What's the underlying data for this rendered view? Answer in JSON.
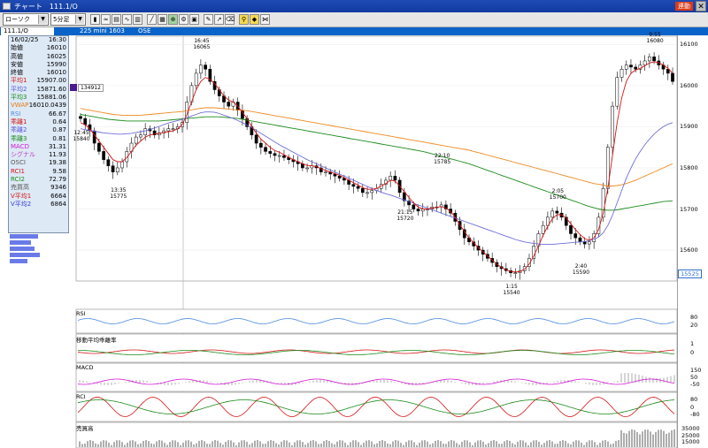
{
  "window": {
    "title": "チャート　111.1/O",
    "badge": "連動",
    "close": "✕"
  },
  "toolbar": {
    "period_select": "ローソク",
    "interval_select": "5分足"
  },
  "infobar": {
    "symbol": "111.1/O",
    "contract": "225 mini 1603",
    "exchange": "OSE"
  },
  "info_panel": [
    {
      "label": "16/02/25",
      "value": "16:30",
      "color": "#000000"
    },
    {
      "label": "始値",
      "value": "16010",
      "color": "#000000"
    },
    {
      "label": "高値",
      "value": "16025",
      "color": "#000000"
    },
    {
      "label": "安値",
      "value": "15990",
      "color": "#000000"
    },
    {
      "label": "終値",
      "value": "16010",
      "color": "#000000"
    },
    {
      "label": "平均1",
      "value": "15907.00",
      "color": "#d41515"
    },
    {
      "label": "平均2",
      "value": "15871.60",
      "color": "#5858d8"
    },
    {
      "label": "平均3",
      "value": "15881.06",
      "color": "#1b8a1b"
    },
    {
      "label": "VWAP",
      "value": "16010.0439",
      "color": "#e47a12"
    },
    {
      "label": "RSI",
      "value": "66.67",
      "color": "#4a8ae0"
    },
    {
      "label": "乖離1",
      "value": "0.64",
      "color": "#d41515"
    },
    {
      "label": "乖離2",
      "value": "0.87",
      "color": "#5858d8"
    },
    {
      "label": "乖離3",
      "value": "0.81",
      "color": "#1b8a1b"
    },
    {
      "label": "MACD",
      "value": "31.31",
      "color": "#d41ad4"
    },
    {
      "label": "シグナル",
      "value": "11.93",
      "color": "#c040c0"
    },
    {
      "label": "OSCI",
      "value": "19.38",
      "color": "#555555"
    },
    {
      "label": "RCI1",
      "value": "9.58",
      "color": "#d41515"
    },
    {
      "label": "RCI2",
      "value": "72.79",
      "color": "#1b8a1b"
    },
    {
      "label": "売買高",
      "value": "9346",
      "color": "#555555"
    },
    {
      "label": "V平均1",
      "value": "6664",
      "color": "#d41515"
    },
    {
      "label": "V平均2",
      "value": "6864",
      "color": "#3a3ad8"
    }
  ],
  "price_tag": "134912",
  "current_price_tag": "15525",
  "annotations": [
    {
      "time": "12:45",
      "price": "15840"
    },
    {
      "time": "13:35",
      "price": "15775"
    },
    {
      "time": "16:45",
      "price": "16065"
    },
    {
      "time": "21:15",
      "price": "15720"
    },
    {
      "time": "22:10",
      "price": "15785"
    },
    {
      "time": "1:15",
      "price": "15540"
    },
    {
      "time": "2:05",
      "price": "15700"
    },
    {
      "time": "2:40",
      "price": "15590"
    },
    {
      "time": "9:55",
      "price": "16080"
    }
  ],
  "price_axis": [
    "16100",
    "16000",
    "15900",
    "15800",
    "15700",
    "15600"
  ],
  "panels": [
    {
      "name": "RSI",
      "ticks": [
        "80",
        "20"
      ]
    },
    {
      "name": "移動平均乖離率",
      "ticks": [
        "1",
        "0"
      ]
    },
    {
      "name": "MACD",
      "ticks": [
        "150",
        "50",
        "-50"
      ]
    },
    {
      "name": "RCI",
      "ticks": [
        "80",
        "0",
        "-80"
      ]
    },
    {
      "name": "売買高",
      "ticks": [
        "35000",
        "25000",
        "15000"
      ]
    }
  ],
  "colors": {
    "candle_up": "#ffffff",
    "candle_down": "#000000",
    "ma1": "#d41515",
    "ma2": "#6e6ed8",
    "ma3": "#1b8a1b",
    "vwap": "#ef8a22",
    "selection_bg": "#2d6fce"
  },
  "chart_data": {
    "type": "line",
    "title": "",
    "ylim": [
      15525,
      16120
    ],
    "close": [
      15920,
      15905,
      15890,
      15860,
      15840,
      15820,
      15805,
      15790,
      15800,
      15815,
      15840,
      15860,
      15875,
      15880,
      15895,
      15890,
      15880,
      15885,
      15890,
      15895,
      15895,
      15900,
      15910,
      15960,
      16000,
      16030,
      16050,
      16040,
      16010,
      15990,
      15975,
      15960,
      15950,
      15960,
      15940,
      15920,
      15900,
      15880,
      15860,
      15850,
      15840,
      15835,
      15830,
      15830,
      15825,
      15820,
      15815,
      15810,
      15800,
      15800,
      15805,
      15800,
      15790,
      15790,
      15785,
      15780,
      15775,
      15770,
      15760,
      15755,
      15750,
      15740,
      15740,
      15745,
      15750,
      15760,
      15770,
      15780,
      15770,
      15740,
      15720,
      15710,
      15700,
      15695,
      15700,
      15700,
      15705,
      15705,
      15710,
      15700,
      15690,
      15670,
      15650,
      15630,
      15620,
      15610,
      15600,
      15590,
      15580,
      15570,
      15560,
      15555,
      15550,
      15545,
      15545,
      15550,
      15560,
      15580,
      15610,
      15640,
      15660,
      15680,
      15695,
      15690,
      15680,
      15660,
      15640,
      15630,
      15620,
      15615,
      15620,
      15640,
      15680,
      15750,
      15850,
      15950,
      16020,
      16040,
      16050,
      16045,
      16040,
      16050,
      16060,
      16070,
      16060,
      16050,
      16040,
      16030,
      16010
    ],
    "ma_short": [
      15910,
      15905,
      15895,
      15880,
      15865,
      15850,
      15835,
      15820,
      15815,
      15815,
      15825,
      15840,
      15855,
      15865,
      15875,
      15880,
      15882,
      15884,
      15886,
      15888,
      15890,
      15895,
      15905,
      15930,
      15960,
      15990,
      16010,
      16020,
      16015,
      16005,
      15990,
      15975,
      15965,
      15960,
      15950,
      15935,
      15920,
      15900,
      15885,
      15870,
      15860,
      15850,
      15842,
      15838,
      15832,
      15826,
      15820,
      15815,
      15810,
      15806,
      15805,
      15803,
      15798,
      15794,
      15790,
      15786,
      15782,
      15776,
      15770,
      15764,
      15758,
      15752,
      15748,
      15748,
      15750,
      15756,
      15762,
      15770,
      15768,
      15756,
      15742,
      15728,
      15715,
      15705,
      15700,
      15700,
      15702,
      15704,
      15706,
      15702,
      15694,
      15680,
      15662,
      15645,
      15630,
      15618,
      15606,
      15596,
      15586,
      15576,
      15566,
      15558,
      15552,
      15548,
      15547,
      15548,
      15554,
      15566,
      15586,
      15610,
      15636,
      15658,
      15676,
      15686,
      15686,
      15678,
      15664,
      15650,
      15638,
      15628,
      15624,
      15630,
      15650,
      15690,
      15750,
      15830,
      15910,
      15970,
      16010,
      16030,
      16038,
      16042,
      16048,
      16055,
      16058,
      16056,
      16050,
      16042,
      16030
    ],
    "ma_mid": [
      15895,
      15893,
      15891,
      15889,
      15887,
      15885,
      15884,
      15883,
      15882,
      15882,
      15883,
      15884,
      15886,
      15888,
      15890,
      15893,
      15897,
      15901,
      15905,
      15909,
      15912,
      15915,
      15918,
      15922,
      15926,
      15930,
      15934,
      15936,
      15936,
      15935,
      15932,
      15928,
      15924,
      15920,
      15915,
      15910,
      15904,
      15898,
      15891,
      15884,
      15877,
      15870,
      15863,
      15856,
      15850,
      15844,
      15838,
      15832,
      15826,
      15820,
      15815,
      15810,
      15805,
      15800,
      15795,
      15790,
      15785,
      15780,
      15775,
      15770,
      15765,
      15760,
      15755,
      15750,
      15745,
      15741,
      15737,
      15734,
      15730,
      15726,
      15722,
      15718,
      15714,
      15710,
      15706,
      15702,
      15698,
      15694,
      15690,
      15686,
      15682,
      15678,
      15674,
      15670,
      15666,
      15662,
      15658,
      15654,
      15650,
      15646,
      15642,
      15638,
      15634,
      15630,
      15626,
      15623,
      15620,
      15618,
      15616,
      15615,
      15614,
      15614,
      15614,
      15615,
      15616,
      15617,
      15618,
      15619,
      15620,
      15621,
      15623,
      15626,
      15632,
      15642,
      15660,
      15685,
      15715,
      15745,
      15775,
      15800,
      15822,
      15840,
      15856,
      15870,
      15882,
      15892,
      15900,
      15906,
      15910
    ],
    "ma_long": [
      15930,
      15928,
      15926,
      15924,
      15922,
      15920,
      15918,
      15917,
      15916,
      15915,
      15914,
      15914,
      15914,
      15914,
      15914,
      15914,
      15914,
      15914,
      15915,
      15916,
      15917,
      15918,
      15919,
      15920,
      15921,
      15922,
      15923,
      15924,
      15924,
      15924,
      15924,
      15923,
      15922,
      15921,
      15920,
      15918,
      15916,
      15914,
      15912,
      15910,
      15908,
      15906,
      15904,
      15902,
      15900,
      15898,
      15896,
      15894,
      15892,
      15890,
      15888,
      15886,
      15884,
      15882,
      15880,
      15878,
      15876,
      15874,
      15872,
      15870,
      15868,
      15866,
      15864,
      15862,
      15860,
      15858,
      15856,
      15854,
      15852,
      15850,
      15848,
      15846,
      15844,
      15842,
      15840,
      15837,
      15834,
      15831,
      15828,
      15825,
      15822,
      15819,
      15816,
      15813,
      15810,
      15806,
      15802,
      15798,
      15794,
      15790,
      15786,
      15782,
      15778,
      15774,
      15770,
      15766,
      15762,
      15758,
      15754,
      15750,
      15746,
      15742,
      15738,
      15734,
      15730,
      15726,
      15722,
      15718,
      15714,
      15710,
      15706,
      15703,
      15700,
      15698,
      15697,
      15697,
      15698,
      15700,
      15702,
      15704,
      15706,
      15708,
      15710,
      15712,
      15714,
      15716,
      15718,
      15719,
      15720
    ],
    "vwap": [
      15945,
      15942,
      15940,
      15938,
      15936,
      15934,
      15932,
      15930,
      15929,
      15928,
      15928,
      15928,
      15928,
      15928,
      15929,
      15930,
      15931,
      15932,
      15933,
      15934,
      15935,
      15936,
      15937,
      15939,
      15941,
      15943,
      15945,
      15946,
      15946,
      15946,
      15945,
      15944,
      15943,
      15942,
      15941,
      15940,
      15939,
      15937,
      15935,
      15933,
      15931,
      15929,
      15927,
      15925,
      15923,
      15921,
      15919,
      15917,
      15915,
      15913,
      15911,
      15909,
      15907,
      15905,
      15903,
      15901,
      15899,
      15897,
      15895,
      15893,
      15891,
      15889,
      15887,
      15885,
      15883,
      15881,
      15879,
      15877,
      15875,
      15873,
      15871,
      15869,
      15867,
      15865,
      15863,
      15861,
      15859,
      15857,
      15855,
      15853,
      15851,
      15849,
      15847,
      15845,
      15843,
      15840,
      15837,
      15834,
      15831,
      15828,
      15825,
      15822,
      15819,
      15816,
      15813,
      15810,
      15807,
      15804,
      15801,
      15798,
      15795,
      15792,
      15789,
      15786,
      15783,
      15780,
      15777,
      15774,
      15771,
      15768,
      15765,
      15762,
      15760,
      15758,
      15756,
      15756,
      15757,
      15759,
      15762,
      15766,
      15770,
      15775,
      15780,
      15785,
      15790,
      15795,
      15800,
      15805,
      15810
    ]
  }
}
